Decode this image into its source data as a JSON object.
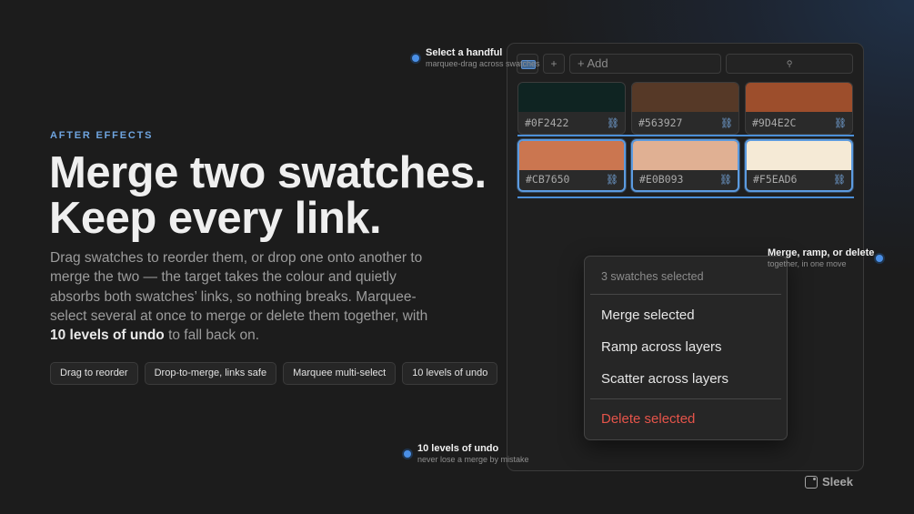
{
  "eyebrow": "AFTER EFFECTS",
  "headline": {
    "line1": "Merge two swatches.",
    "line2": "Keep every link."
  },
  "body": {
    "text": "Drag swatches to reorder them, or drop one onto another to merge the two — the target takes the colour and quietly absorbs both swatches’ links, so nothing breaks. Marquee-select several at once to merge or delete them together, with ",
    "emphasis": "10 levels of undo",
    "tail": " to fall back on."
  },
  "chips": [
    "Drag to reorder",
    "Drop-to-merge, links safe",
    "Marquee multi-select",
    "10 levels of undo"
  ],
  "toolbar": {
    "plus_label": "+",
    "add_placeholder": "+ Add",
    "search_glyph": "⚲"
  },
  "swatches": [
    {
      "hex": "#0F2422",
      "color": "#0F2422",
      "selected": false
    },
    {
      "hex": "#563927",
      "color": "#563927",
      "selected": false
    },
    {
      "hex": "#9D4E2C",
      "color": "#9D4E2C",
      "selected": false
    },
    {
      "hex": "#CB7650",
      "color": "#CB7650",
      "selected": true
    },
    {
      "hex": "#E0B093",
      "color": "#E0B093",
      "selected": true
    },
    {
      "hex": "#F5EAD6",
      "color": "#F5EAD6",
      "selected": true
    }
  ],
  "link_icon": "link-icon",
  "link_glyph": "⛓",
  "context_menu": {
    "header": "3 swatches selected",
    "items": [
      "Merge selected",
      "Ramp across layers",
      "Scatter across layers"
    ],
    "danger_item": "Delete selected"
  },
  "callouts": {
    "select": {
      "title": "Select a handful",
      "sub": "marquee-drag across swatches"
    },
    "merge": {
      "title": "Merge, ramp, or delete",
      "sub": "together, in one move"
    },
    "undo": {
      "title": "10 levels of undo",
      "sub": "never lose a merge by mistake"
    }
  },
  "brand": "Sleek",
  "colors": {
    "accent": "#4C8FD8",
    "danger": "#E5544A",
    "background": "#1C1C1C"
  }
}
